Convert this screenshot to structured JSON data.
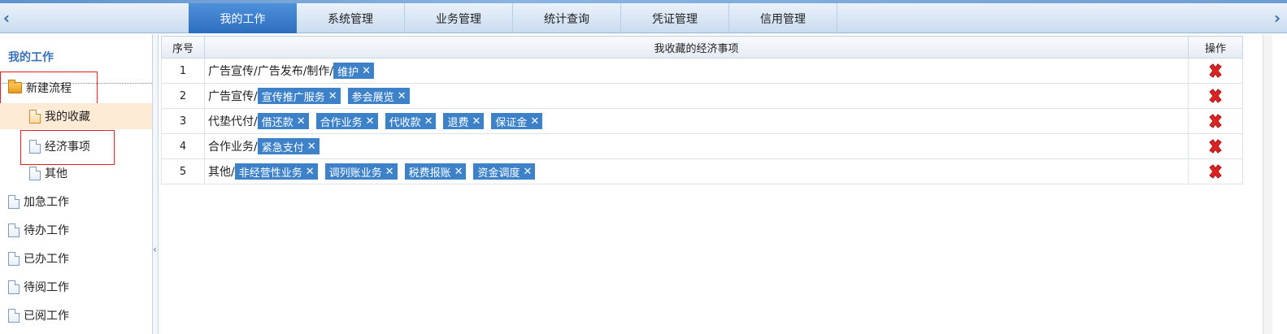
{
  "nav": {
    "tabs": [
      "我的工作",
      "系统管理",
      "业务管理",
      "统计查询",
      "凭证管理",
      "信用管理"
    ],
    "active_tab": "我的工作"
  },
  "sidebar": {
    "title": "我的工作",
    "items": [
      {
        "label": "新建流程",
        "icon": "folder-icon"
      },
      {
        "label": "我的收藏",
        "icon": "document-icon"
      },
      {
        "label": "经济事项",
        "icon": "document-icon"
      },
      {
        "label": "其他",
        "icon": "document-icon"
      },
      {
        "label": "加急工作",
        "icon": "document-icon"
      },
      {
        "label": "待办工作",
        "icon": "document-icon"
      },
      {
        "label": "已办工作",
        "icon": "document-icon"
      },
      {
        "label": "待阅工作",
        "icon": "document-icon"
      },
      {
        "label": "已阅工作",
        "icon": "document-icon"
      }
    ]
  },
  "table": {
    "headers": {
      "no": "序号",
      "items": "我收藏的经济事项",
      "op": "操作"
    },
    "tag_remove_glyph": "✕",
    "rows": [
      {
        "no": "1",
        "path": "广告宣传/广告发布/制作/",
        "tags": [
          "维护"
        ]
      },
      {
        "no": "2",
        "path": "广告宣传/",
        "tags": [
          "宣传推广服务",
          "参会展览"
        ]
      },
      {
        "no": "3",
        "path": "代垫代付/",
        "tags": [
          "借还款",
          "合作业务",
          "代收款",
          "退费",
          "保证金"
        ]
      },
      {
        "no": "4",
        "path": "合作业务/",
        "tags": [
          "紧急支付"
        ]
      },
      {
        "no": "5",
        "path": "其他/",
        "tags": [
          "非经营性业务",
          "调列账业务",
          "税费报账",
          "资金调度"
        ]
      }
    ]
  },
  "colors": {
    "accent": "#2d6fbf",
    "tag": "#3d82c8",
    "delete": "#e02222",
    "highlight": "#fdebd6"
  }
}
